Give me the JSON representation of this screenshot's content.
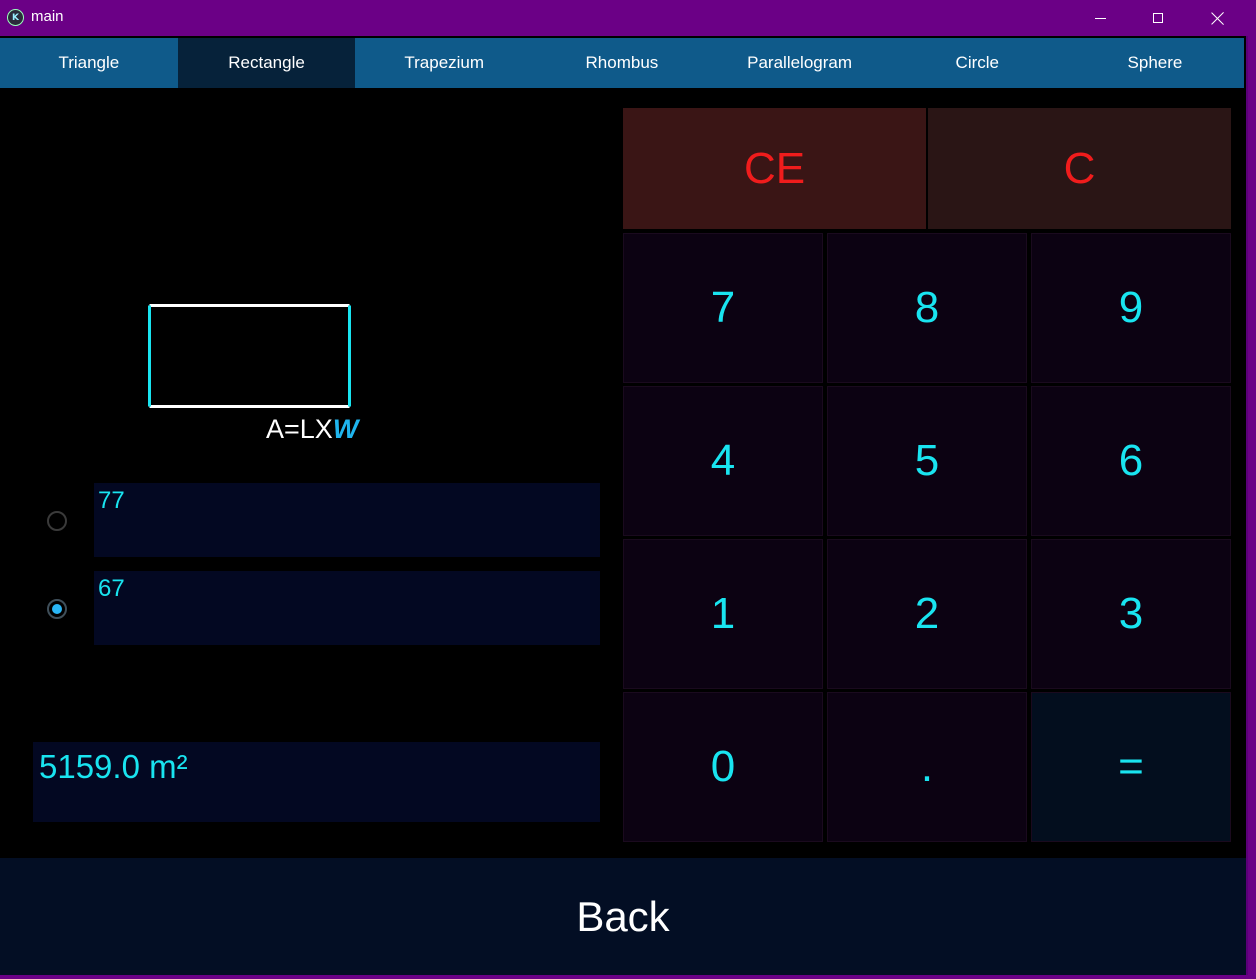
{
  "window": {
    "title": "main"
  },
  "tabs": [
    {
      "label": "Triangle"
    },
    {
      "label": "Rectangle"
    },
    {
      "label": "Trapezium"
    },
    {
      "label": "Rhombus"
    },
    {
      "label": "Parallelogram"
    },
    {
      "label": "Circle"
    },
    {
      "label": "Sphere"
    }
  ],
  "active_tab": "Rectangle",
  "formula": {
    "prefix": "A=LX",
    "highlight": "W"
  },
  "inputs": [
    {
      "value": "77",
      "selected": false
    },
    {
      "value": "67",
      "selected": true
    }
  ],
  "result": {
    "text": "5159.0  m²"
  },
  "keypad": {
    "ce": "CE",
    "c": "C",
    "keys": [
      "7",
      "8",
      "9",
      "4",
      "5",
      "6",
      "1",
      "2",
      "3",
      "0",
      ".",
      "="
    ]
  },
  "back_label": "Back",
  "colors": {
    "titlebar": "#6b0086",
    "tabbar": "#0f5a8a",
    "accent_cyan": "#19e4f0",
    "clear_red": "#f01c1c"
  }
}
